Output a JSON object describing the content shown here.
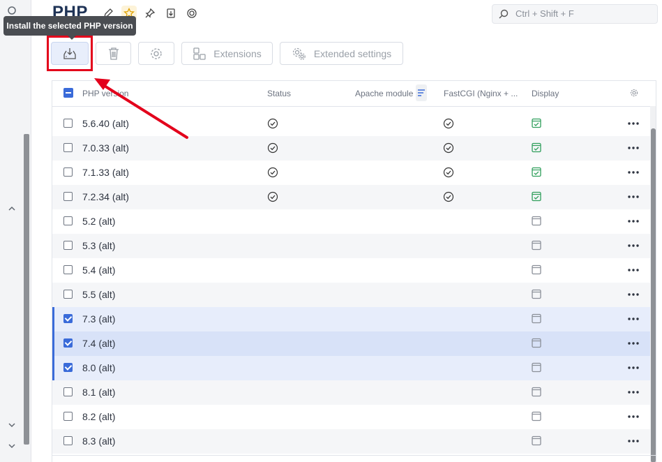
{
  "header": {
    "title": "PHP",
    "icons": [
      "pencil-icon",
      "star-icon",
      "pin-icon",
      "download-page-icon",
      "lifebuoy-icon"
    ],
    "search_placeholder": "Ctrl + Shift + F"
  },
  "tooltip": {
    "text": "Install the selected PHP version"
  },
  "toolbar": {
    "install_icon": "install-icon",
    "delete_icon": "trash-icon",
    "settings_icon": "gear-icon",
    "extensions_label": "Extensions",
    "extended_settings_label": "Extended settings"
  },
  "table": {
    "columns": {
      "php_version": "PHP version",
      "status": "Status",
      "apache_module": "Apache module",
      "fastcgi": "FastCGI (Nginx + ...",
      "display": "Display"
    },
    "rows": [
      {
        "name": "5.6.40 (alt)",
        "checked": false,
        "status_ok": true,
        "fastcgi_ok": true,
        "display_on": true
      },
      {
        "name": "7.0.33 (alt)",
        "checked": false,
        "status_ok": true,
        "fastcgi_ok": true,
        "display_on": true
      },
      {
        "name": "7.1.33 (alt)",
        "checked": false,
        "status_ok": true,
        "fastcgi_ok": true,
        "display_on": true
      },
      {
        "name": "7.2.34 (alt)",
        "checked": false,
        "status_ok": true,
        "fastcgi_ok": true,
        "display_on": true
      },
      {
        "name": "5.2 (alt)",
        "checked": false,
        "status_ok": false,
        "fastcgi_ok": false,
        "display_on": false
      },
      {
        "name": "5.3 (alt)",
        "checked": false,
        "status_ok": false,
        "fastcgi_ok": false,
        "display_on": false
      },
      {
        "name": "5.4 (alt)",
        "checked": false,
        "status_ok": false,
        "fastcgi_ok": false,
        "display_on": false
      },
      {
        "name": "5.5 (alt)",
        "checked": false,
        "status_ok": false,
        "fastcgi_ok": false,
        "display_on": false
      },
      {
        "name": "7.3 (alt)",
        "checked": true,
        "status_ok": false,
        "fastcgi_ok": false,
        "display_on": false
      },
      {
        "name": "7.4 (alt)",
        "checked": true,
        "status_ok": false,
        "fastcgi_ok": false,
        "display_on": false
      },
      {
        "name": "8.0 (alt)",
        "checked": true,
        "status_ok": false,
        "fastcgi_ok": false,
        "display_on": false
      },
      {
        "name": "8.1 (alt)",
        "checked": false,
        "status_ok": false,
        "fastcgi_ok": false,
        "display_on": false
      },
      {
        "name": "8.2 (alt)",
        "checked": false,
        "status_ok": false,
        "fastcgi_ok": false,
        "display_on": false
      },
      {
        "name": "8.3 (alt)",
        "checked": false,
        "status_ok": false,
        "fastcgi_ok": false,
        "display_on": false
      }
    ]
  },
  "colors": {
    "accent": "#3a6bd9",
    "annotation": "#e3001b",
    "display_on": "#2f9e5b",
    "title": "#1f3356"
  }
}
